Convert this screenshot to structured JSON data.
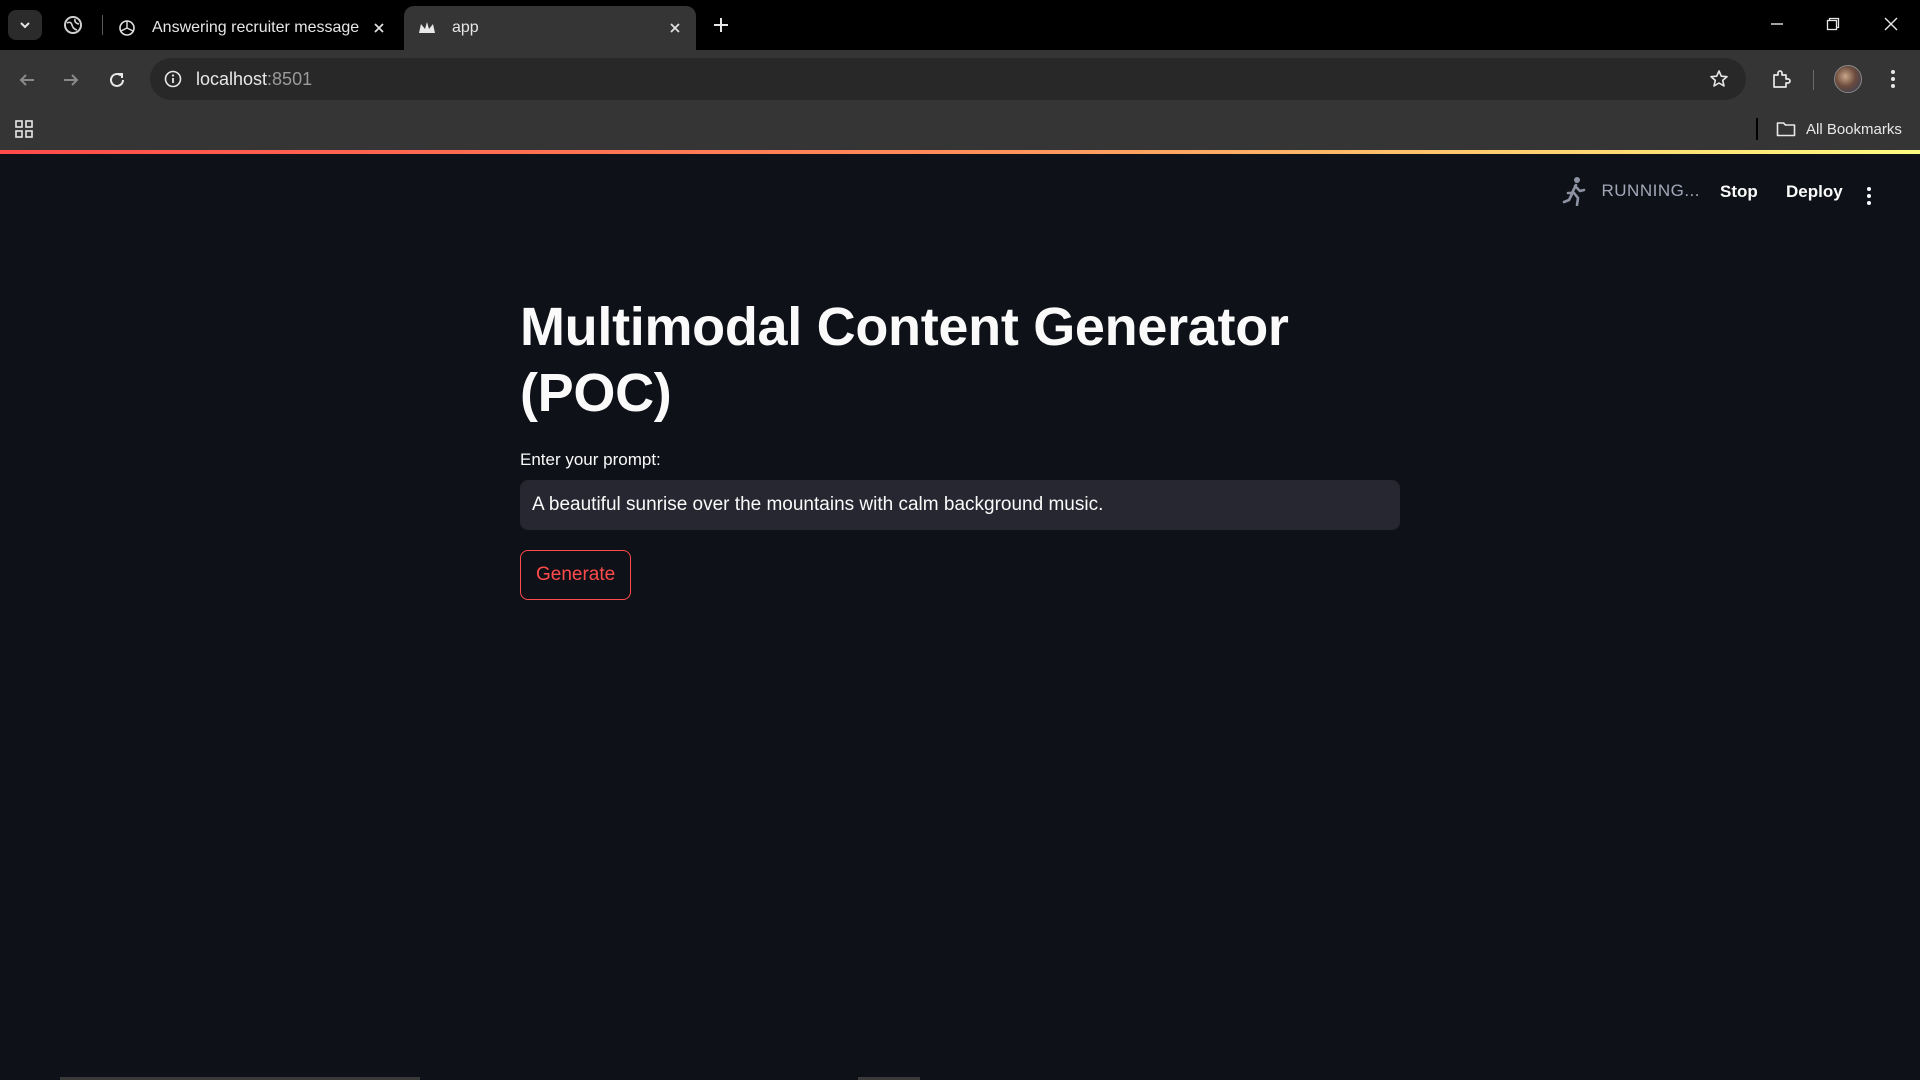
{
  "browser": {
    "tabs": [
      {
        "title": "Answering recruiter message",
        "icon": "openai-icon",
        "active": false
      },
      {
        "title": "app",
        "icon": "streamlit-crown-icon",
        "active": true
      }
    ],
    "address": {
      "host": "localhost",
      "port": ":8501"
    },
    "bookmarks_label": "All Bookmarks",
    "accent": "#ff4b4b"
  },
  "app": {
    "status": "RUNNING...",
    "stop_label": "Stop",
    "deploy_label": "Deploy",
    "title": "Multimodal Content Generator (POC)",
    "prompt_label": "Enter your prompt:",
    "prompt_value": "A beautiful sunrise over the mountains with calm background music.",
    "generate_label": "Generate"
  }
}
